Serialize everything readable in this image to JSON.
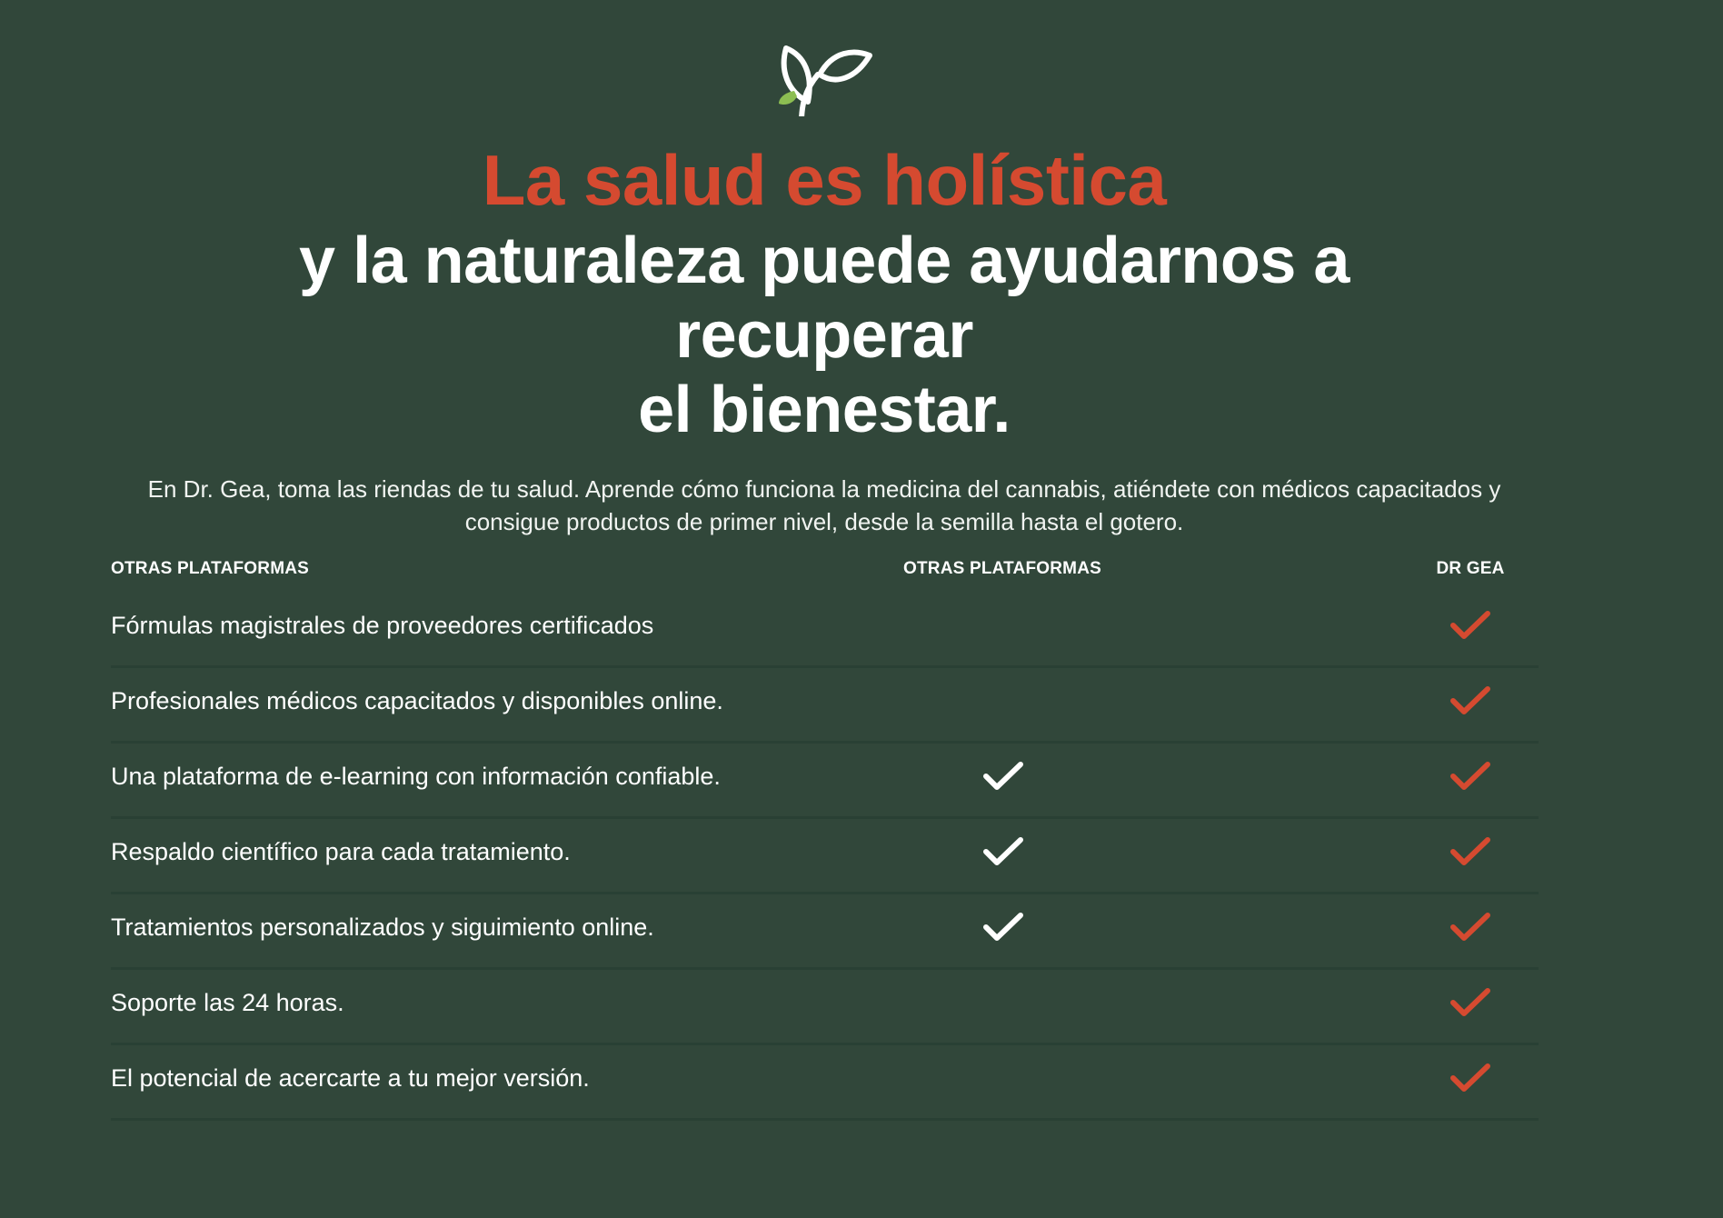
{
  "hero": {
    "accent_title": "La salud es holística",
    "main_title_line1": "y la naturaleza puede ayudarnos a recuperar",
    "main_title_line2": "el bienestar.",
    "description": "En Dr. Gea, toma las riendas de tu salud. Aprende cómo funciona la medicina del cannabis, atiéndete con médicos capacitados y consigue productos de primer nivel, desde la semilla hasta el gotero."
  },
  "table": {
    "header_feature": "OTRAS PLATAFORMAS",
    "header_other": "OTRAS PLATAFORMAS",
    "header_drgea": "DR GEA",
    "rows": [
      {
        "label": "Fórmulas magistrales de proveedores certificados",
        "other_check": false,
        "drgea_check": true
      },
      {
        "label": "Profesionales médicos capacitados y disponibles online.",
        "other_check": false,
        "drgea_check": true
      },
      {
        "label": "Una plataforma de e-learning con información confiable.",
        "other_check": true,
        "drgea_check": true
      },
      {
        "label": "Respaldo científico para cada tratamiento.",
        "other_check": true,
        "drgea_check": true
      },
      {
        "label": "Tratamientos personalizados y siguimiento online.",
        "other_check": true,
        "drgea_check": true
      },
      {
        "label": "Soporte las 24 horas.",
        "other_check": false,
        "drgea_check": true
      },
      {
        "label": "El potencial de acercarte a tu mejor versión.",
        "other_check": false,
        "drgea_check": true
      }
    ]
  },
  "icons": {
    "logo": "plant-icon",
    "check": "check-icon"
  },
  "colors": {
    "background": "#31473a",
    "accent": "#d54a30",
    "text": "#ffffff",
    "leaf": "#8cbe52",
    "divider": "#294034"
  }
}
